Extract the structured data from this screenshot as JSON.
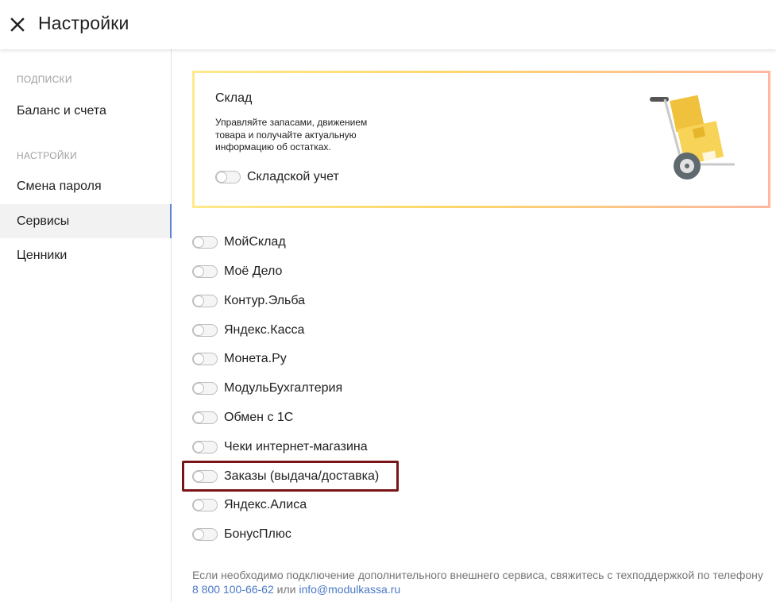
{
  "header": {
    "title": "Настройки",
    "close_icon": "close-icon"
  },
  "sidebar": {
    "section_subscriptions": "ПОДПИСКИ",
    "section_settings": "НАСТРОЙКИ",
    "items": [
      {
        "label": "Баланс и счета"
      },
      {
        "label": "Смена пароля"
      },
      {
        "label": "Сервисы",
        "active": true
      },
      {
        "label": "Ценники"
      }
    ]
  },
  "promo": {
    "title": "Склад",
    "description": "Управляйте запасами, движением товара и получайте актуальную информацию об остатках.",
    "toggle_label": "Складской учет",
    "toggle_on": false,
    "illustration_icon": "hand-truck-boxes-icon"
  },
  "services": [
    {
      "label": "МойСклад",
      "on": false
    },
    {
      "label": "Моё Дело",
      "on": false
    },
    {
      "label": "Контур.Эльба",
      "on": false
    },
    {
      "label": "Яндекс.Касса",
      "on": false
    },
    {
      "label": "Монета.Ру",
      "on": false
    },
    {
      "label": "МодульБухгалтерия",
      "on": false
    },
    {
      "label": "Обмен с 1С",
      "on": false
    },
    {
      "label": "Чеки интернет-магазина",
      "on": false
    },
    {
      "label": "Заказы (выдача/доставка)",
      "on": false,
      "highlighted": true
    },
    {
      "label": "Яндекс.Алиса",
      "on": false
    },
    {
      "label": "БонусПлюс",
      "on": false
    }
  ],
  "footer": {
    "text": "Если необходимо подключение дополнительного внешнего сервиса, свяжитесь с техподдержкой по телефону",
    "phone": "8 800 100-66-62",
    "or": "или",
    "email": "info@modulkassa.ru"
  },
  "colors": {
    "accent": "#5b84d6",
    "link": "#4a78c6",
    "highlight_border": "#7a1517",
    "promo_gradient_start": "#ffe98a",
    "promo_gradient_end": "#ffb7a0"
  }
}
